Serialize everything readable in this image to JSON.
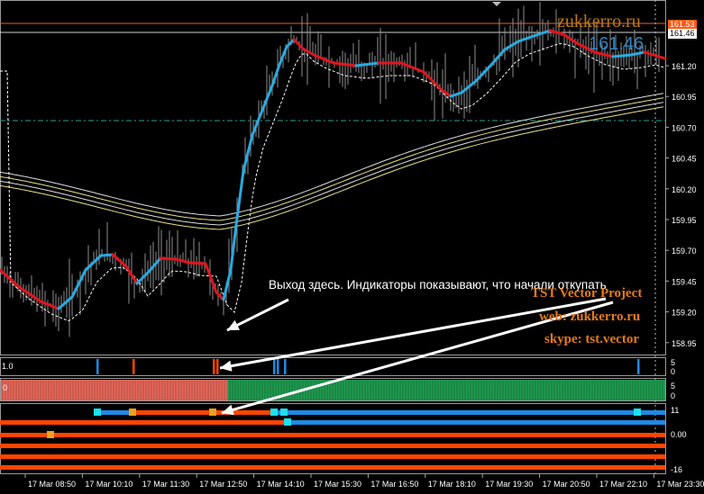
{
  "watermark": "zukkerro.ru",
  "current_price_large": "161.46",
  "price_tags": {
    "upper": "161.53",
    "lower": "161.46"
  },
  "price_axis": [
    "161.20",
    "160.95",
    "160.70",
    "160.45",
    "160.20",
    "159.95",
    "159.70",
    "159.45",
    "159.20",
    "158.95"
  ],
  "time_axis": [
    "17 Mar 08:50",
    "17 Mar 10:10",
    "17 Mar 11:30",
    "17 Mar 12:50",
    "17 Mar 14:10",
    "17 Mar 15:30",
    "17 Mar 16:50",
    "17 Mar 18:10",
    "17 Mar 19:30",
    "17 Mar 20:50",
    "17 Mar 22:10",
    "17 Mar 23:30"
  ],
  "annotation_text": "Выход здесь. Индикаторы показывают, что начали откупать",
  "branding": {
    "project": "TST Vector Project",
    "web": "web: zukkerro.ru",
    "skype": "skype: tst.vector"
  },
  "indicator1": {
    "label_left": "1.0",
    "scale": [
      "5",
      "0"
    ]
  },
  "indicator2": {
    "label_left": "0",
    "scale": [
      "5",
      "0"
    ]
  },
  "indicator3": {
    "scale": [
      "11",
      "0.00",
      "-16"
    ]
  },
  "colors": {
    "up": "#29aae1",
    "down": "#e0141e",
    "ma_envelope": "#e9e08a",
    "bar_red": "#e8685a",
    "bar_green": "#1f9c50",
    "orange": "#ff4500",
    "blue_bar": "#1e8ae6"
  }
}
